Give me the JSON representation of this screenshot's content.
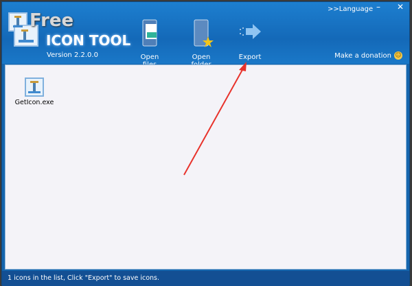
{
  "app": {
    "logo_top": "Free",
    "logo_bottom": "ICON TOOL",
    "version": "Version 2.2.0.0"
  },
  "toolbar": {
    "open_files": "Open files",
    "open_folder": "Open folder",
    "export": "Export"
  },
  "window": {
    "language": ">>Language",
    "minimize": "–",
    "close": "✕"
  },
  "donate": {
    "label": "Make a donation"
  },
  "list": {
    "items": [
      {
        "name": "GetIcon.exe"
      }
    ]
  },
  "status": {
    "text": "1 icons in the list, Click \"Export\" to save icons."
  },
  "colors": {
    "header": "#1469b8",
    "status": "#134f93",
    "arrow": "#e8322b"
  }
}
